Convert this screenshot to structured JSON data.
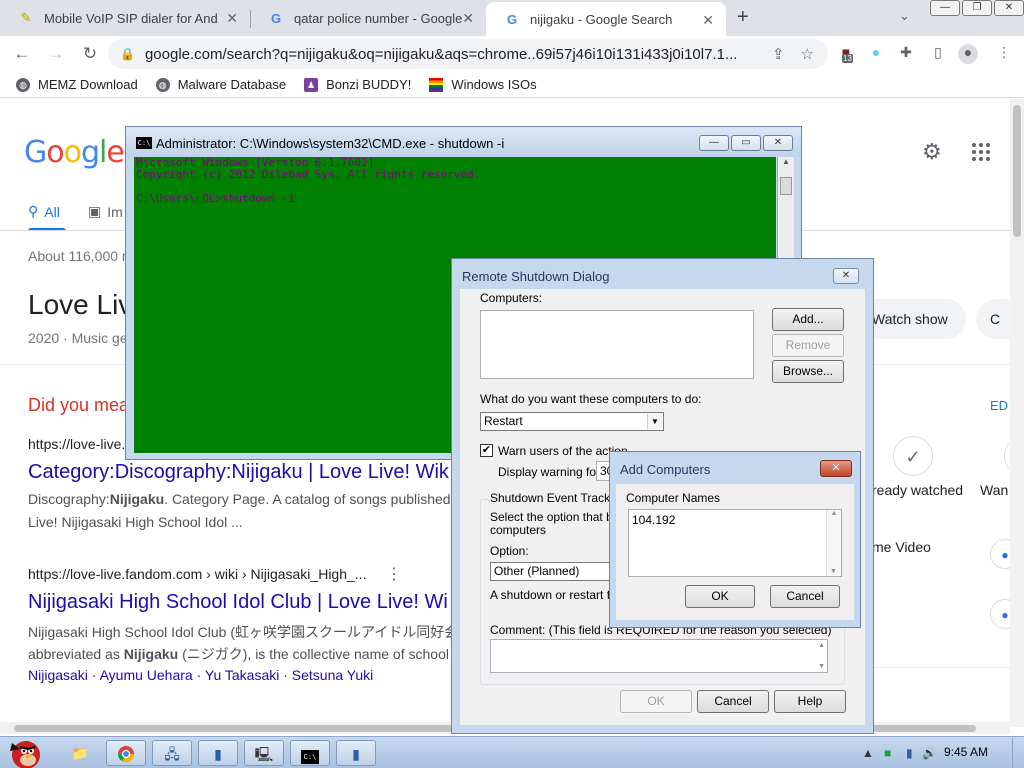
{
  "browser": {
    "tabs": [
      {
        "title": "Mobile VoIP SIP dialer for And",
        "icon": "pen-icon"
      },
      {
        "title": "qatar police number - Google",
        "icon": "google-icon"
      },
      {
        "title": "nijigaku - Google Search",
        "icon": "google-icon"
      }
    ],
    "url": "google.com/search?q=nijigaku&oq=nijigaku&aqs=chrome..69i57j46i10i131i433j0i10l7.1...",
    "extension_badge": "13",
    "bookmarks": [
      "MEMZ Download",
      "Malware Database",
      "Bonzi BUDDY!",
      "Windows ISOs"
    ]
  },
  "google": {
    "logo": [
      "G",
      "o",
      "o",
      "g",
      "l",
      "e"
    ],
    "tab_all": "All",
    "tab_images": "Im",
    "result_count": "About 116,000 r",
    "kp_title": "Love Liv",
    "kp_subtitle": "2020 · Music ge",
    "did_you_mean": "Did you mea",
    "result1_url": "https://love-live.",
    "result1_title": "Category:Discography:Nijigaku | Love Live! Wik",
    "result1_snip1_a": "Discography:",
    "result1_snip1_b": "Nijigaku",
    "result1_snip1_c": ". Category Page. A catalog of songs published",
    "result1_snip2": "Live! Nijigasaki High School Idol ...",
    "result2_url": "https://love-live.fandom.com › wiki › Nijigasaki_High_...",
    "result2_title": "Nijigasaki High School Idol Club | Love Live! Wi",
    "result2_snip1": "Nijigasaki High School Idol Club (虹ヶ咲学園スクールアイドル同好会",
    "result2_snip2_a": "abbreviated as ",
    "result2_snip2_b": "Nijigaku",
    "result2_snip2_c": " (ニジガク), is the collective name of school",
    "result2_links": "Nijigasaki · Ayumu Uehara · Yu Takasaki · Setsuna Yuki",
    "watch_show": "Watch show",
    "partial_c": "C",
    "edit_partial": "ED",
    "already_watched": "ready watched",
    "want_partial": "Wan",
    "prime_video": "me Video"
  },
  "cmd": {
    "title": "Administrator: C:\\Windows\\system32\\CMD.exe - shutdown  -i",
    "line1": "Microsoft Windows [Version 6.1.7601]",
    "line2": "Copyright (c) 2012 Dilebad Sys.  All rights reserved.",
    "line3": "C:\\Users\\LOL>shutdown -i"
  },
  "shutdown_dialog": {
    "title": "Remote Shutdown Dialog",
    "computers_label": "Computers:",
    "add_btn": "Add...",
    "remove_btn": "Remove",
    "browse_btn": "Browse...",
    "action_label": "What do you want these computers to do:",
    "action_value": "Restart",
    "warn_label": "Warn users of the action",
    "warn_checked": true,
    "display_warning_label": "Display warning for",
    "display_warning_value": "30",
    "tracker_label": "Shutdown Event Tracker",
    "select_option_line1": "Select the option that bes",
    "select_option_line2": "computers",
    "option_label": "Option:",
    "option_value": "Other (Planned)",
    "planned_desc": "A shutdown or restart for",
    "comment_label": "Comment: (This field is REQUIRED for the reason you selected)",
    "ok_btn": "OK",
    "cancel_btn": "Cancel",
    "help_btn": "Help"
  },
  "add_dialog": {
    "title": "Add Computers",
    "names_label": "Computer Names",
    "names_value": "104.192",
    "ok_btn": "OK",
    "cancel_btn": "Cancel"
  },
  "taskbar": {
    "clock": "9:45 AM"
  }
}
